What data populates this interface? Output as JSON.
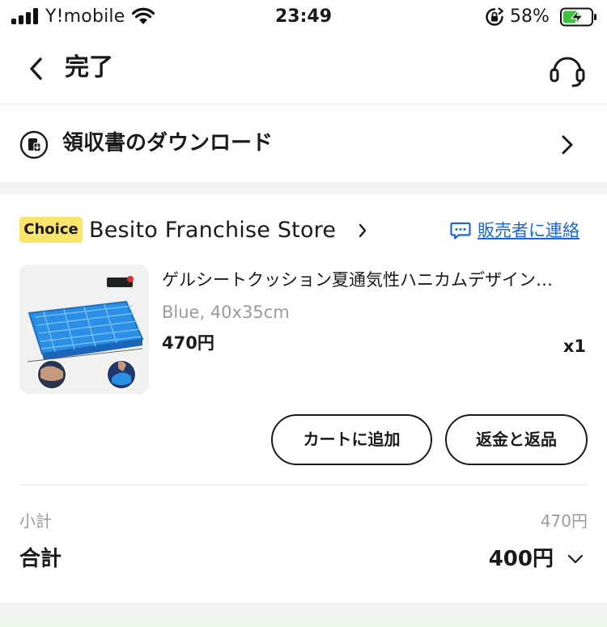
{
  "status_bar": {
    "carrier": "Y!mobile",
    "time": "23:49",
    "battery_percent": "58%",
    "battery_level": 0.58,
    "battery_color": "#3dc13c"
  },
  "nav": {
    "title": "完了",
    "back_icon": "chevron-left-icon",
    "support_icon": "headset-icon"
  },
  "receipt": {
    "label": "領収書のダウンロード",
    "icon": "receipt-download-icon"
  },
  "store": {
    "badge": "Choice",
    "badge_color": "#fbe46b",
    "name": "Besito Franchise Store",
    "contact_label": "販売者に連絡",
    "link_color": "#1d64d6"
  },
  "product": {
    "title": "ゲルシートクッション夏通気性ハニカムデザイン…",
    "variant": "Blue, 40x35cm",
    "price": "470円",
    "quantity": "x1",
    "image_icon": "gel-seat-cushion-image"
  },
  "actions": {
    "add_to_cart": "カートに追加",
    "refund_return": "返金と返品"
  },
  "summary": {
    "subtotal_label": "小計",
    "subtotal_value": "470円",
    "total_label": "合計",
    "total_value": "400円"
  }
}
